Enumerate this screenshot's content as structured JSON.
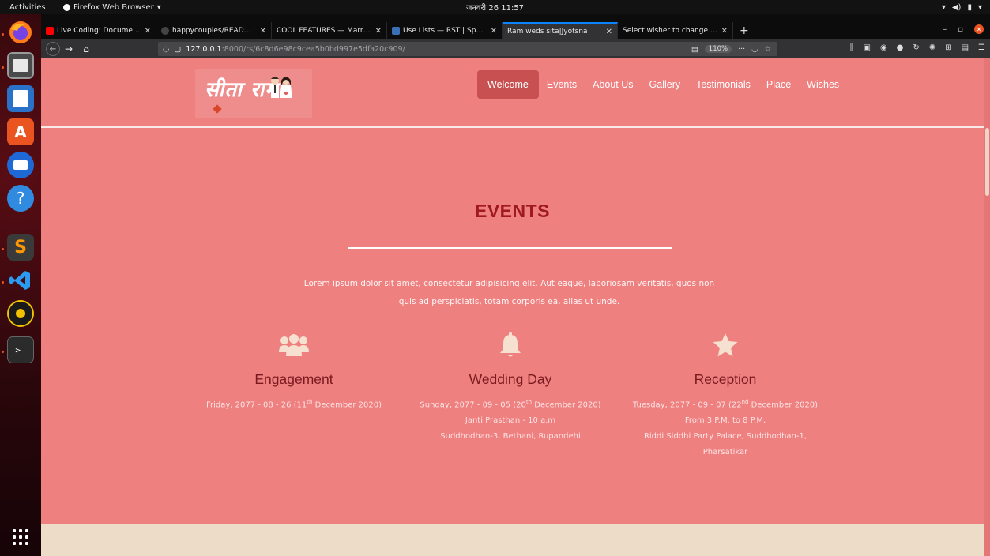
{
  "system": {
    "activities": "Activities",
    "app_name": "Firefox Web Browser",
    "clock": "जनवरी 26  11:57"
  },
  "browser": {
    "tabs": [
      {
        "title": "Live Coding: Documenta",
        "favicon_color": "#ff0000"
      },
      {
        "title": "happycouples/README.",
        "favicon_color": "#444444"
      },
      {
        "title": "COOL FEATURES — Marriag",
        "favicon_color": "#ffffff"
      },
      {
        "title": "Use Lists — RST | Sphinx",
        "favicon_color": "#3b6fb6"
      },
      {
        "title": "Ram weds sita|Jyotsna",
        "favicon_color": "#323234"
      },
      {
        "title": "Select wisher to change | Dj",
        "favicon_color": "#0c4b33"
      }
    ],
    "new_tab": "+",
    "url_host": "127.0.0.1",
    "url_path": ":8000/rs/6c8d6e98c9cea5b0bd997e5dfa20c909/",
    "zoom": "110%",
    "page_actions": "···"
  },
  "site": {
    "logo_text": "सीता राम",
    "nav": [
      "Welcome",
      "Events",
      "About Us",
      "Gallery",
      "Testimonials",
      "Place",
      "Wishes"
    ],
    "active_nav": "Welcome",
    "section_title": "EVENTS",
    "intro_line1": "Lorem ipsum dolor sit amet, consectetur adipisicing elit. Aut eaque, laboriosam veritatis, quos non",
    "intro_line2": "quis ad perspiciatis, totam corporis ea, alias ut unde.",
    "events": [
      {
        "icon": "users-icon",
        "title": "Engagement",
        "date_prefix": "Friday, 2077 - 08 - 26 (11",
        "date_sup": "th",
        "date_suffix": " December 2020)",
        "lines": []
      },
      {
        "icon": "bell-icon",
        "title": "Wedding Day",
        "date_prefix": "Sunday, 2077 - 09 - 05 (20",
        "date_sup": "th",
        "date_suffix": " December 2020)",
        "lines": [
          "Janti Prasthan - 10 a.m",
          "Suddhodhan-3, Bethani, Rupandehi"
        ]
      },
      {
        "icon": "star-icon",
        "title": "Reception",
        "date_prefix": "Tuesday, 2077 - 09 - 07 (22",
        "date_sup": "nd",
        "date_suffix": " December 2020)",
        "lines": [
          "From 3 P.M. to 8 P.M.",
          "Riddi Siddhi Party Palace, Suddhodhan-1,",
          "Pharsatikar"
        ]
      }
    ]
  },
  "colors": {
    "page_bg": "#ee8080",
    "title": "#a01820",
    "event_title": "#7a1a1e",
    "icon": "#f6e0cf",
    "nav_active": "#c85050",
    "band": "#edddc8"
  }
}
